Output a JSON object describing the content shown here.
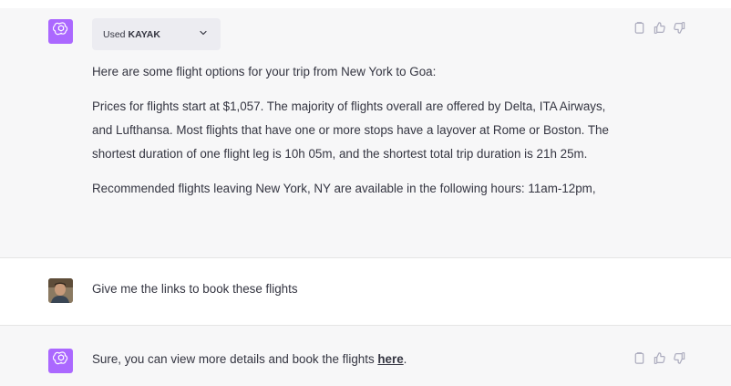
{
  "colors": {
    "assistant_bg": "#f7f7f8",
    "user_bg": "#ffffff",
    "bot_avatar": "#ab68ff",
    "text": "#343541",
    "icon": "#acacbe"
  },
  "messages": [
    {
      "role": "assistant",
      "avatar_icon": "openai-logo-icon",
      "plugin": {
        "used_label": "Used",
        "name": "KAYAK"
      },
      "paragraphs": [
        "Here are some flight options for your trip from New York to Goa:",
        "Prices for flights start at $1,057. The majority of flights overall are offered by Delta, ITA Airways, and Lufthansa. Most flights that have one or more stops have a layover at Rome or Boston. The shortest duration of one flight leg is 10h 05m, and the shortest total trip duration is 21h 25m.",
        "Recommended flights leaving New York, NY are available in the following hours: 11am-12pm,"
      ],
      "actions": [
        "clipboard-icon",
        "thumbs-up-icon",
        "thumbs-down-icon"
      ]
    },
    {
      "role": "user",
      "avatar_icon": "user-avatar",
      "text": "Give me the links to book these flights"
    },
    {
      "role": "assistant",
      "avatar_icon": "openai-logo-icon",
      "text_before": "Sure, you can view more details and book the flights ",
      "link_text": "here",
      "text_after": ".",
      "actions": [
        "clipboard-icon",
        "thumbs-up-icon",
        "thumbs-down-icon"
      ]
    }
  ]
}
